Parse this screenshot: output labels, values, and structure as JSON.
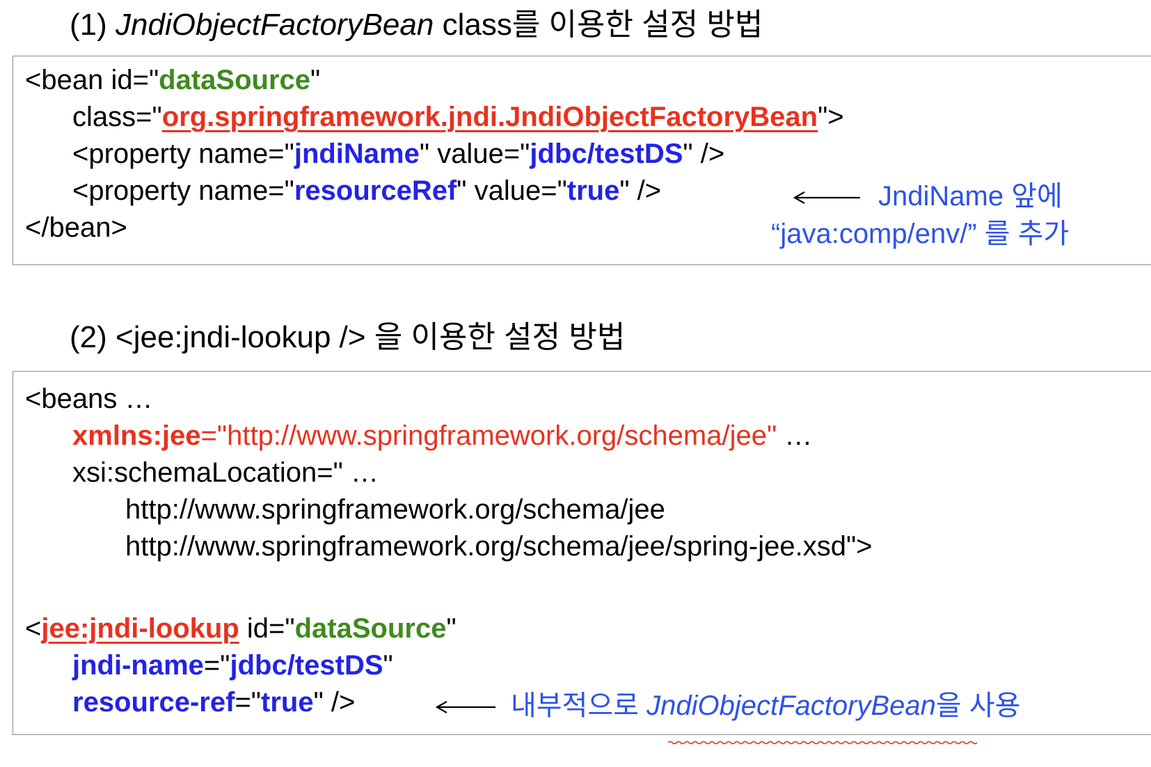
{
  "section1": {
    "heading_prefix": "(1) ",
    "heading_class_name": "JndiObjectFactoryBean",
    "heading_suffix": " class를 이용한 설정 방법",
    "code": {
      "l1_a": "<bean id=\"",
      "l1_b": "dataSource",
      "l1_c": "\"",
      "l2_a": "class=\"",
      "l2_b": "org.springframework.jndi.JndiObjectFactoryBean",
      "l2_c": "\">",
      "l3_a": "<property name=\"",
      "l3_b": "jndiName",
      "l3_c": "\" value=\"",
      "l3_d": "jdbc/testDS",
      "l3_e": "\" />",
      "l4_a": "<property name=\"",
      "l4_b": "resourceRef",
      "l4_c": "\" value=\"",
      "l4_d": "true",
      "l4_e": "\" />",
      "l5": "</bean>"
    },
    "note_line1": "JndiName 앞에",
    "note_line2": "“java:comp/env/” 를 추가"
  },
  "section2": {
    "heading_prefix": "(2) ",
    "heading_tag": "<jee:jndi-lookup />",
    "heading_suffix": " 을 이용한 설정 방법",
    "code": {
      "l1": "<beans …",
      "l2_a": "xmlns:jee",
      "l2_b": "=\"http://www.springframework.org/schema/jee\"",
      "l2_c": " …",
      "l3": "xsi:schemaLocation=\" …",
      "l4": "http://www.springframework.org/schema/jee",
      "l5": "http://www.springframework.org/schema/jee/spring-jee.xsd\">",
      "l6_a": "<",
      "l6_b": "jee:jndi-lookup",
      "l6_c": "  id=\"",
      "l6_d": "dataSource",
      "l6_e": "\"",
      "l7_a": "jndi-name",
      "l7_b": "=\"",
      "l7_c": "jdbc/testDS",
      "l7_d": "\"",
      "l8_a": "resource-ref",
      "l8_b": "=\"",
      "l8_c": "true",
      "l8_d": "\" />"
    },
    "note_prefix": "내부적으로 ",
    "note_class_name": "JndiObjectFactoryBean",
    "note_suffix": "을 사용"
  },
  "colors": {
    "green": "#3f8a1f",
    "red": "#e8321f",
    "blue": "#2323e6",
    "note_blue": "#2e52e8",
    "border": "#8c8c8c"
  },
  "icons": [
    "left-arrow-icon",
    "left-arrow-icon"
  ]
}
